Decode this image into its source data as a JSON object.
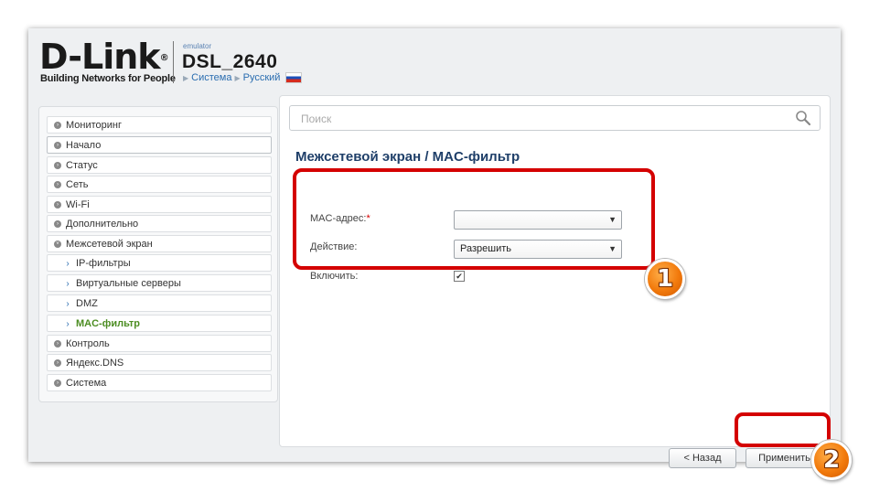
{
  "header": {
    "logo": "D-Link",
    "logo_reg": "®",
    "tagline": "Building Networks for People",
    "emulator": "emulator",
    "model": "DSL_2640",
    "crumb_system": "Система",
    "crumb_language": "Русский"
  },
  "sidebar": {
    "items": [
      {
        "label": "Мониторинг"
      },
      {
        "label": "Начало"
      },
      {
        "label": "Статус"
      },
      {
        "label": "Сеть"
      },
      {
        "label": "Wi-Fi"
      },
      {
        "label": "Дополнительно"
      },
      {
        "label": "Межсетевой экран"
      },
      {
        "label": "IP-фильтры"
      },
      {
        "label": "Виртуальные серверы"
      },
      {
        "label": "DMZ"
      },
      {
        "label": "MAC-фильтр"
      },
      {
        "label": "Контроль"
      },
      {
        "label": "Яндекс.DNS"
      },
      {
        "label": "Система"
      }
    ]
  },
  "search": {
    "placeholder": "Поиск"
  },
  "page": {
    "title": "Межсетевой экран /  MAC-фильтр",
    "mac_label": "MAC-адрес:",
    "required_mark": "*",
    "mac_value": "",
    "action_label": "Действие:",
    "action_value": "Разрешить",
    "enable_label": "Включить:",
    "enable_checked": true
  },
  "buttons": {
    "back": "< Назад",
    "apply": "Применить"
  },
  "annotations": {
    "badge_1": "1",
    "badge_2": "2"
  },
  "colors": {
    "highlight": "#d40000",
    "accent": "#2a6db0",
    "active": "#4c8d22",
    "badge": "#f27a0c"
  }
}
